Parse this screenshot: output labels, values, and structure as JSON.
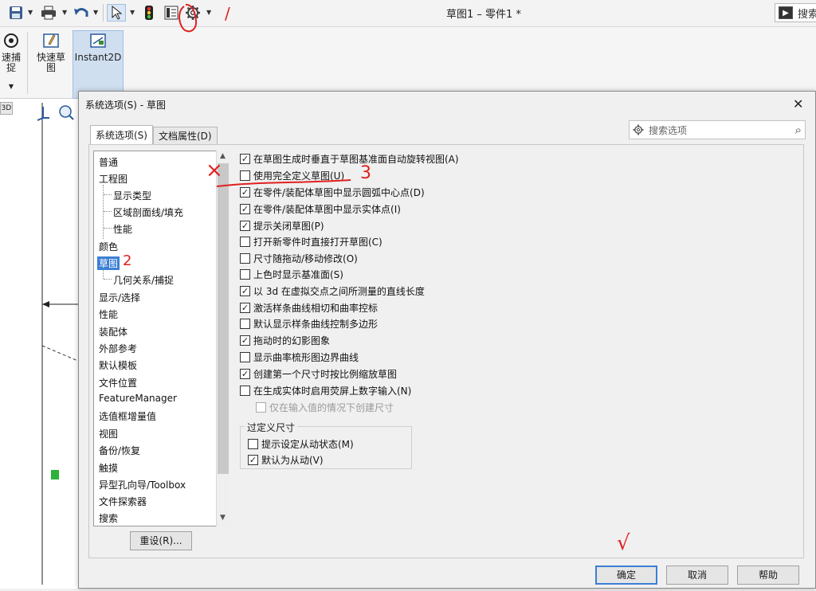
{
  "app": {
    "window_title": "草图1 – 零件1 *",
    "search_label": "搜索"
  },
  "ribbon": {
    "snap_label": "速捕\n捉",
    "quick_sketch_label": "快速草\n图",
    "instant2d_label": "Instant2D",
    "view_3d_label": "3D"
  },
  "dialog": {
    "title": "系统选项(S) - 草图",
    "close_glyph": "✕",
    "tabs": [
      {
        "label": "系统选项(S)"
      },
      {
        "label": "文档属性(D)"
      }
    ],
    "search_placeholder": "搜索选项",
    "tree": [
      {
        "label": "普通"
      },
      {
        "label": "工程图"
      },
      {
        "label": "显示类型"
      },
      {
        "label": "区域剖面线/填充"
      },
      {
        "label": "性能"
      },
      {
        "label": "颜色"
      },
      {
        "label": "草图"
      },
      {
        "label": "几何关系/捕捉"
      },
      {
        "label": "显示/选择"
      },
      {
        "label": "性能"
      },
      {
        "label": "装配体"
      },
      {
        "label": "外部参考"
      },
      {
        "label": "默认模板"
      },
      {
        "label": "文件位置"
      },
      {
        "label": "FeatureManager"
      },
      {
        "label": "选值框增量值"
      },
      {
        "label": "视图"
      },
      {
        "label": "备份/恢复"
      },
      {
        "label": "触摸"
      },
      {
        "label": "异型孔向导/Toolbox"
      },
      {
        "label": "文件探索器"
      },
      {
        "label": "搜索"
      }
    ],
    "reset_label": "重设(R)...",
    "options": [
      {
        "label": "在草图生成时垂直于草图基准面自动旋转视图(A)",
        "checked": true
      },
      {
        "label": "使用完全定义草图(U)",
        "checked": false
      },
      {
        "label": "在零件/装配体草图中显示圆弧中心点(D)",
        "checked": true
      },
      {
        "label": "在零件/装配体草图中显示实体点(I)",
        "checked": true
      },
      {
        "label": "提示关闭草图(P)",
        "checked": true
      },
      {
        "label": "打开新零件时直接打开草图(C)",
        "checked": false
      },
      {
        "label": "尺寸随拖动/移动修改(O)",
        "checked": false
      },
      {
        "label": "上色时显示基准面(S)",
        "checked": false
      },
      {
        "label": "以 3d 在虚拟交点之间所测量的直线长度",
        "checked": true
      },
      {
        "label": "激活样条曲线相切和曲率控标",
        "checked": true
      },
      {
        "label": "默认显示样条曲线控制多边形",
        "checked": false
      },
      {
        "label": "拖动时的幻影图象",
        "checked": true
      },
      {
        "label": "显示曲率梳形图边界曲线",
        "checked": false
      },
      {
        "label": "创建第一个尺寸时按比例缩放草图",
        "checked": true
      },
      {
        "label": "在生成实体时启用荧屏上数字输入(N)",
        "checked": false
      }
    ],
    "sub_option": {
      "label": "仅在输入值的情况下创建尺寸",
      "checked": false
    },
    "overdefined_group": {
      "title": "过定义尺寸",
      "options": [
        {
          "label": "提示设定从动状态(M)",
          "checked": false
        },
        {
          "label": "默认为从动(V)",
          "checked": true
        }
      ]
    },
    "buttons": {
      "ok": "确定",
      "cancel": "取消",
      "help": "帮助"
    }
  },
  "annotations": {
    "mark_1": "/",
    "mark_2": "2",
    "mark_3": "3",
    "mark_x": "×",
    "mark_check": "√",
    "color": "#e02020"
  }
}
